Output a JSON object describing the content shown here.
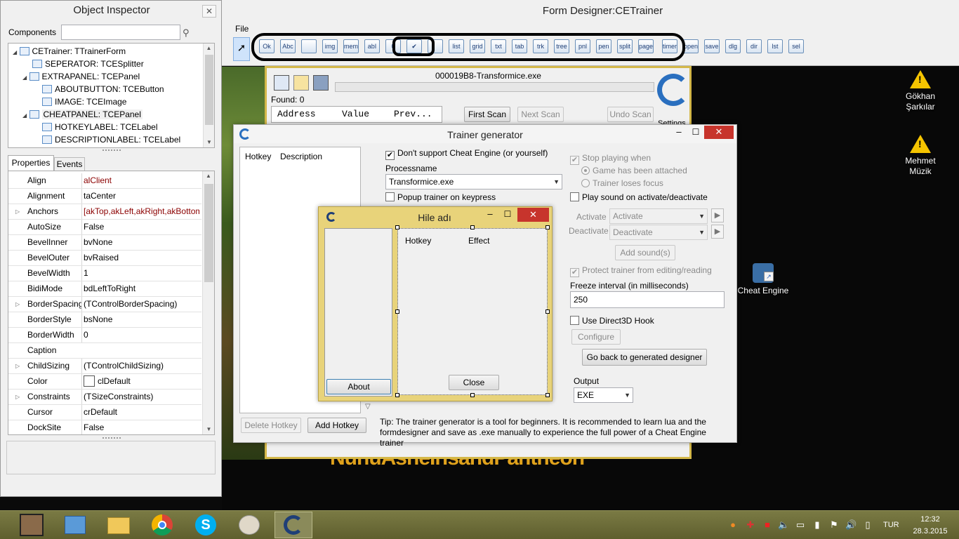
{
  "object_inspector": {
    "title": "Object Inspector",
    "components_label": "Components",
    "tree": [
      {
        "label": "CETrainer: TTrainerForm",
        "level": 0
      },
      {
        "label": "SEPERATOR: TCESplitter",
        "level": 1
      },
      {
        "label": "EXTRAPANEL: TCEPanel",
        "level": 1
      },
      {
        "label": "ABOUTBUTTON: TCEButton",
        "level": 2
      },
      {
        "label": "IMAGE: TCEImage",
        "level": 2
      },
      {
        "label": "CHEATPANEL: TCEPanel",
        "level": 1
      },
      {
        "label": "HOTKEYLABEL: TCELabel",
        "level": 2
      },
      {
        "label": "DESCRIPTIONLABEL: TCELabel",
        "level": 2
      }
    ],
    "tabs": [
      "Properties",
      "Events"
    ],
    "properties": [
      {
        "name": "Align",
        "value": "alClient",
        "color": "#8b0000",
        "expand": false
      },
      {
        "name": "Alignment",
        "value": "taCenter",
        "color": "#000000",
        "expand": false
      },
      {
        "name": "Anchors",
        "value": "[akTop,akLeft,akRight,akBottom]",
        "color": "#8b0000",
        "expand": true
      },
      {
        "name": "AutoSize",
        "value": "False",
        "color": "#000000",
        "expand": false
      },
      {
        "name": "BevelInner",
        "value": "bvNone",
        "color": "#000000",
        "expand": false
      },
      {
        "name": "BevelOuter",
        "value": "bvRaised",
        "color": "#000000",
        "expand": false
      },
      {
        "name": "BevelWidth",
        "value": "1",
        "color": "#000000",
        "expand": false
      },
      {
        "name": "BidiMode",
        "value": "bdLeftToRight",
        "color": "#000000",
        "expand": false
      },
      {
        "name": "BorderSpacing",
        "value": "(TControlBorderSpacing)",
        "color": "#000000",
        "expand": true
      },
      {
        "name": "BorderStyle",
        "value": "bsNone",
        "color": "#000000",
        "expand": false
      },
      {
        "name": "BorderWidth",
        "value": "0",
        "color": "#000000",
        "expand": false
      },
      {
        "name": "Caption",
        "value": "",
        "color": "#000000",
        "expand": false
      },
      {
        "name": "ChildSizing",
        "value": "(TControlChildSizing)",
        "color": "#000000",
        "expand": true
      },
      {
        "name": "Color",
        "value": "clDefault",
        "color": "#000000",
        "expand": false
      },
      {
        "name": "Constraints",
        "value": "(TSizeConstraints)",
        "color": "#000000",
        "expand": true
      },
      {
        "name": "Cursor",
        "value": "crDefault",
        "color": "#000000",
        "expand": false
      },
      {
        "name": "DockSite",
        "value": "False",
        "color": "#000000",
        "expand": false
      }
    ]
  },
  "form_designer": {
    "title": "Form Designer:CETrainer",
    "menu_file": "File",
    "toolbar": [
      "Ok",
      "Abc",
      "",
      "img",
      "memo",
      "abI",
      "0",
      "✔",
      "",
      "list",
      "grid",
      "txt",
      "tab",
      "trk",
      "tree",
      "pnl",
      "pen",
      "split",
      "page",
      "timer",
      "open",
      "save",
      "dlg",
      "dir",
      "lst",
      "sel"
    ]
  },
  "ce_main": {
    "process": "000019B8-Transformice.exe",
    "found": "Found: 0",
    "columns": [
      "Address",
      "Value",
      "Prev..."
    ],
    "first_scan": "First Scan",
    "next_scan": "Next Scan",
    "undo_scan": "Undo Scan",
    "settings": "Settings"
  },
  "trainer_generator": {
    "title": "Trainer generator",
    "hotkey_col": "Hotkey",
    "description_col": "Description",
    "dont_support": "Don't support Cheat Engine (or yourself)",
    "processname_label": "Processname",
    "processname_value": "Transformice.exe",
    "popup_trainer": "Popup trainer on keypress",
    "stop_playing": "Stop playing when",
    "game_attached": "Game has been attached",
    "trainer_loses_focus": "Trainer loses focus",
    "play_sound": "Play sound on activate/deactivate",
    "activate_label": "Activate",
    "activate_value": "Activate",
    "deactivate_label": "Deactivate",
    "deactivate_value": "Deactivate",
    "add_sounds": "Add sound(s)",
    "protect_trainer": "Protect trainer from editing/reading",
    "freeze_interval_label": "Freeze interval (in milliseconds)",
    "freeze_interval_value": "250",
    "use_d3d": "Use Direct3D Hook",
    "configure": "Configure",
    "go_back": "Go back to generated designer",
    "output_label": "Output",
    "output_value": "EXE",
    "delete_hotkey": "Delete Hotkey",
    "add_hotkey": "Add Hotkey",
    "tip": "Tip: The trainer generator is a tool for beginners. It is recommended to learn lua and the formdesigner and save as .exe manually to experience the full power of a Cheat Engine trainer"
  },
  "hile": {
    "title": "Hile adı",
    "hotkey_col": "Hotkey",
    "effect_col": "Effect",
    "about": "About",
    "close": "Close"
  },
  "desktop": {
    "icons": [
      "Gökhan Şarkılar",
      "Mehmet Müzik",
      "Cheat Engine"
    ],
    "banner": "NunuAsheIrisandPantheon"
  },
  "taskbar": {
    "lang": "TUR",
    "time": "12:32",
    "date": "28.3.2015"
  },
  "colors": {
    "accent": "#d4b84a",
    "close_red": "#c7342c",
    "taskbar": "#6b6b36"
  }
}
